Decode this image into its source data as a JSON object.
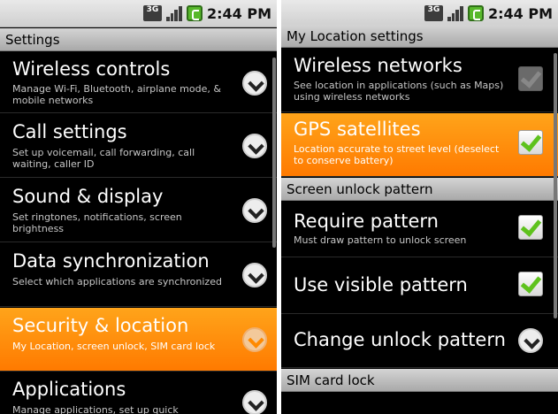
{
  "status": {
    "network": "3G",
    "time": "2:44 PM"
  },
  "left": {
    "header": "Settings",
    "items": [
      {
        "title": "Wireless controls",
        "subtitle": "Manage Wi-Fi, Bluetooth, airplane mode, & mobile networks"
      },
      {
        "title": "Call settings",
        "subtitle": "Set up voicemail, call forwarding, call waiting, caller ID"
      },
      {
        "title": "Sound & display",
        "subtitle": "Set ringtones, notifications, screen brightness"
      },
      {
        "title": "Data synchronization",
        "subtitle": "Select which applications are synchronized"
      },
      {
        "title": "Security & location",
        "subtitle": "My Location, screen unlock, SIM card lock"
      },
      {
        "title": "Applications",
        "subtitle": "Manage applications, set up quick"
      }
    ]
  },
  "right": {
    "header1": "My Location settings",
    "items1": [
      {
        "title": "Wireless networks",
        "subtitle": "See location in applications (such as Maps) using wireless networks"
      },
      {
        "title": "GPS satellites",
        "subtitle": "Location accurate to street level (deselect to conserve battery)"
      }
    ],
    "header2": "Screen unlock pattern",
    "items2": [
      {
        "title": "Require pattern",
        "subtitle": "Must draw pattern to unlock screen"
      },
      {
        "title": "Use visible pattern"
      },
      {
        "title": "Change unlock pattern"
      }
    ],
    "header3": "SIM card lock"
  },
  "colors": {
    "accent": "#ff8a00",
    "check": "#5ec21d"
  },
  "icons": {
    "chevron": "chevron-down-icon",
    "checkbox": "checkbox-icon"
  }
}
